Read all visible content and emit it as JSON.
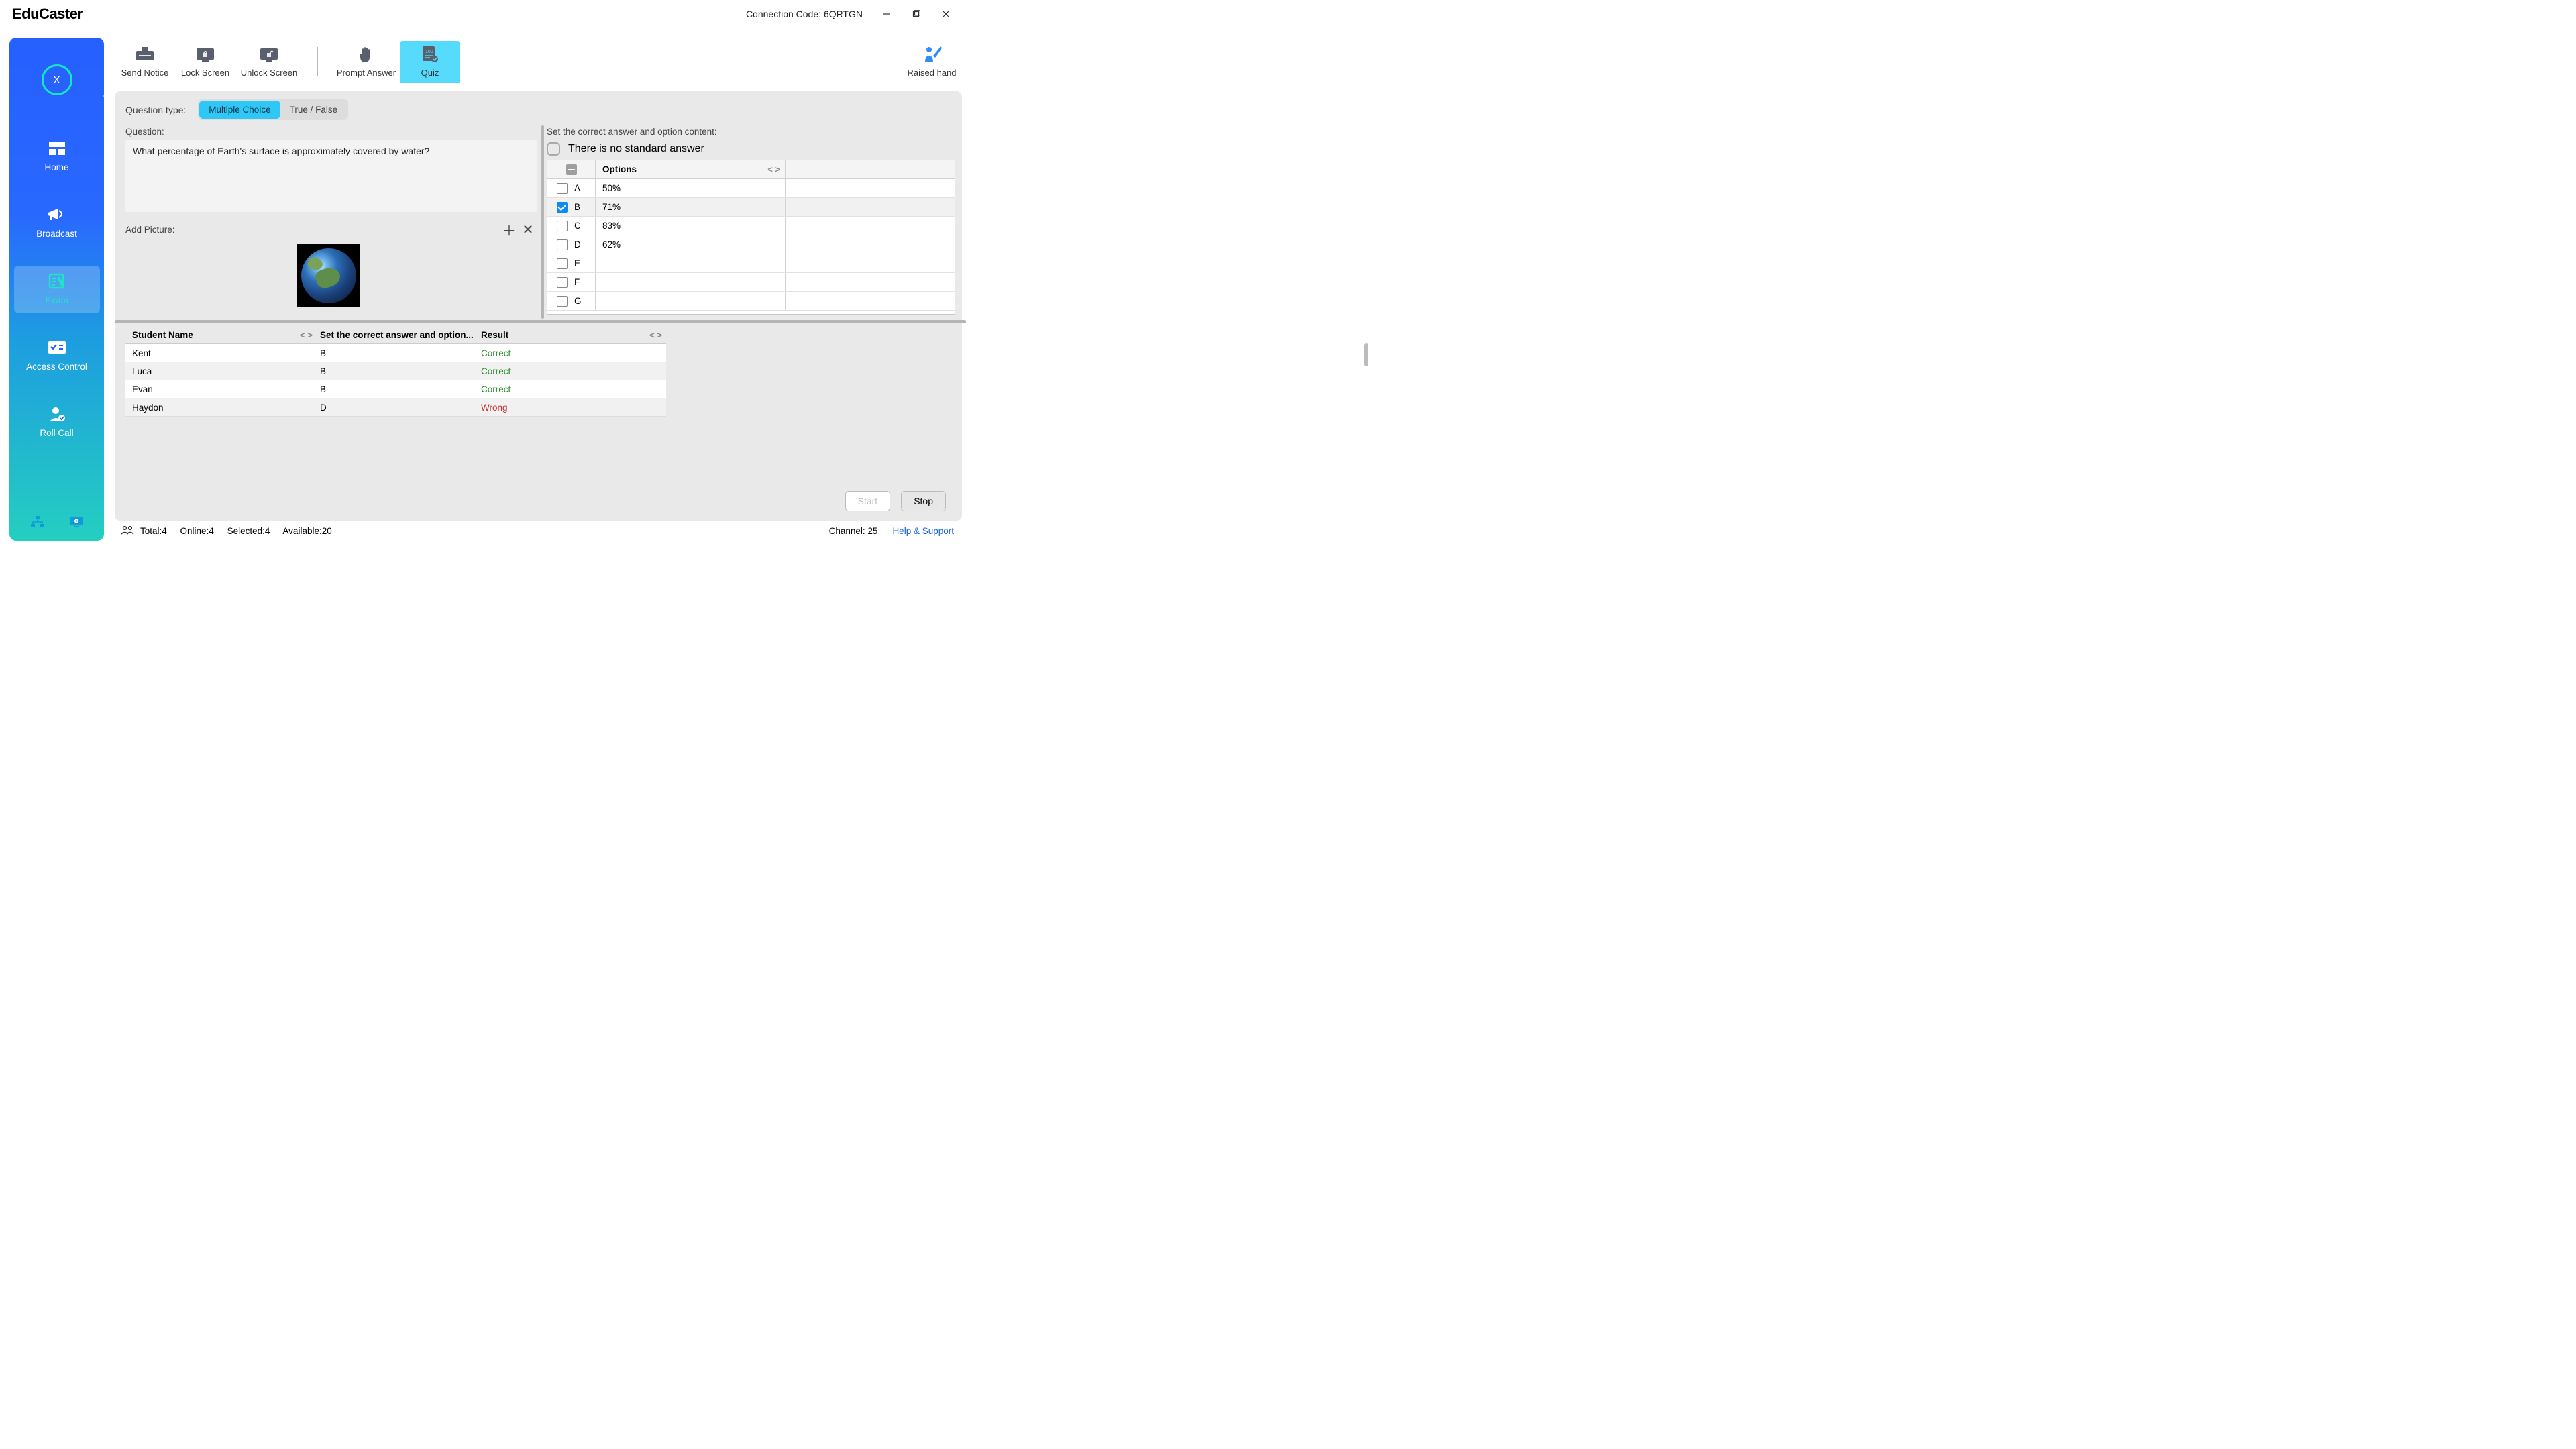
{
  "title": "EduCaster",
  "connection_code_label": "Connection Code: 6QRTGN",
  "avatar_letter": "X",
  "sidebar": {
    "items": [
      {
        "id": "home",
        "label": "Home"
      },
      {
        "id": "broadcast",
        "label": "Broadcast"
      },
      {
        "id": "exam",
        "label": "Exam",
        "active": true
      },
      {
        "id": "access",
        "label": "Access Control"
      },
      {
        "id": "rollcall",
        "label": "Roll Call"
      }
    ]
  },
  "toolbar": {
    "send_notice": "Send Notice",
    "lock_screen": "Lock Screen",
    "unlock_screen": "Unlock Screen",
    "prompt_answer": "Prompt Answer",
    "quiz": "Quiz",
    "raised_hand": "Raised hand"
  },
  "quiz": {
    "question_type_label": "Question type:",
    "types": {
      "mc": "Multiple Choice",
      "tf": "True / False"
    },
    "active_type": "mc",
    "question_label": "Question:",
    "question_text": "What percentage of Earth's surface is approximately covered by water?",
    "add_picture_label": "Add Picture:",
    "answer_header": "Set the correct answer and option content:",
    "no_standard_label": "There is no standard answer",
    "options_header": "Options",
    "options": [
      {
        "letter": "A",
        "value": "50%",
        "correct": false
      },
      {
        "letter": "B",
        "value": "71%",
        "correct": true
      },
      {
        "letter": "C",
        "value": "83%",
        "correct": false
      },
      {
        "letter": "D",
        "value": "62%",
        "correct": false
      },
      {
        "letter": "E",
        "value": "",
        "correct": false
      },
      {
        "letter": "F",
        "value": "",
        "correct": false
      },
      {
        "letter": "G",
        "value": "",
        "correct": false
      }
    ]
  },
  "results": {
    "headers": {
      "name": "Student Name",
      "answer": "Set the correct answer and option...",
      "result": "Result"
    },
    "rows": [
      {
        "name": "Kent",
        "answer": "B",
        "result": "Correct",
        "ok": true
      },
      {
        "name": "Luca",
        "answer": "B",
        "result": "Correct",
        "ok": true
      },
      {
        "name": "Evan",
        "answer": "B",
        "result": "Correct",
        "ok": true
      },
      {
        "name": "Haydon",
        "answer": "D",
        "result": "Wrong",
        "ok": false
      }
    ]
  },
  "buttons": {
    "start": "Start",
    "stop": "Stop"
  },
  "status": {
    "total": "Total:4",
    "online": "Online:4",
    "selected": "Selected:4",
    "available": "Available:20",
    "channel": "Channel: 25",
    "help": "Help & Support"
  }
}
